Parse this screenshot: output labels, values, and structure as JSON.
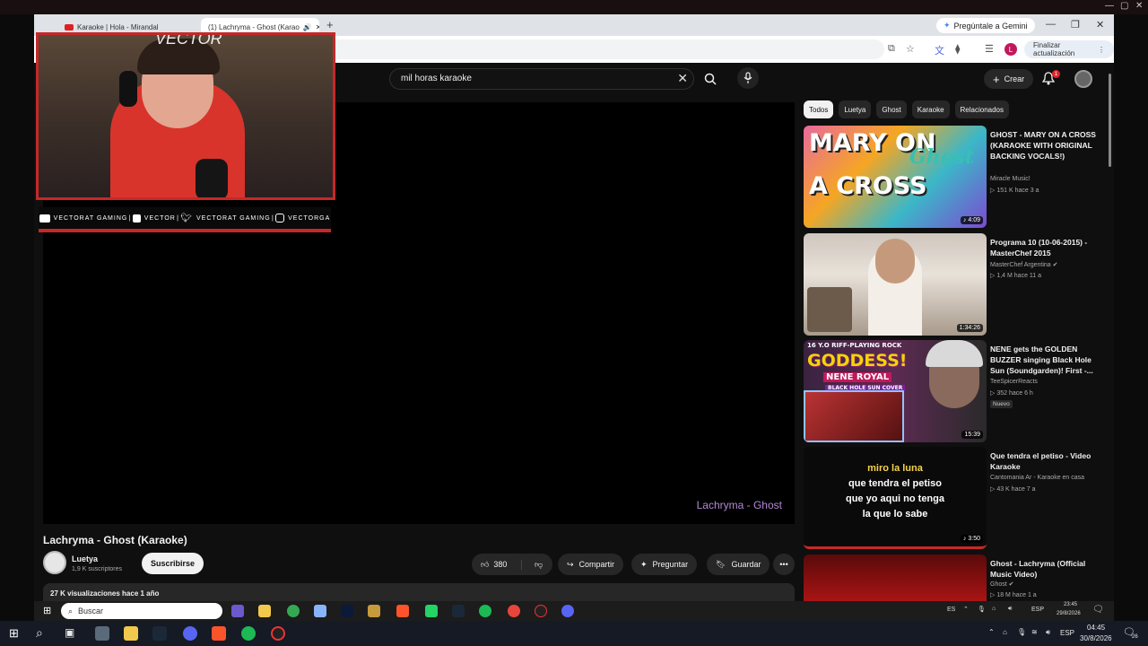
{
  "browser": {
    "tabs": [
      {
        "label": "Karaoke | Hola - Mirandal"
      },
      {
        "label": "(1) Lachryma - Ghost (Karao"
      }
    ],
    "gemini_label": "Pregúntale a Gemini",
    "update_label": "Finalizar actualización",
    "profile_letter": "L"
  },
  "header": {
    "search_value": "mil horas karaoke",
    "create_label": "Crear",
    "notification_count": "1"
  },
  "player": {
    "lyric_caption": "Lachryma - Ghost"
  },
  "video": {
    "title": "Lachryma - Ghost (Karaoke)",
    "channel": "Luetya",
    "subscribers": "1,9 K suscriptores",
    "subscribe_label": "Suscribirse",
    "likes": "380",
    "share_label": "Compartir",
    "ask_label": "Preguntar",
    "save_label": "Guardar",
    "description_meta": "27 K visualizaciones  hace 1 año"
  },
  "chips": [
    "Todos",
    "Luetya",
    "Ghost",
    "Karaoke",
    "Relacionados"
  ],
  "recommendations": [
    {
      "title": "GHOST - MARY ON A CROSS (KARAOKE WITH ORIGINAL BACKING VOCALS!)",
      "channel": "Miracle Music!",
      "meta": "▷ 151 K   hace 3 a",
      "duration": "4:09",
      "thumb_text": [
        "MARY ON",
        "A CROSS"
      ],
      "thumb_logo": "Ghost"
    },
    {
      "title": "Programa 10 (10-06-2015) - MasterChef 2015",
      "channel": "MasterChef Argentina",
      "meta": "▷ 1,4 M   hace 11 a",
      "duration": "1:34:26"
    },
    {
      "title": "NENE gets the GOLDEN BUZZER singing Black Hole Sun (Soundgarden)!  First -...",
      "channel": "TeeSpicerReacts",
      "meta": "▷ 352   hace 6 h",
      "badge": "Nuevo",
      "duration": "15:39",
      "thumb_text": [
        "16 Y.O RIFF-PLAYING ROCK",
        "GODDESS!",
        "NENE ROYAL",
        "BLACK HOLE SUN COVER"
      ]
    },
    {
      "title": "Que tendra el petiso - Video Karaoke",
      "channel": "Cantomania Ar - Karaoke en casa",
      "meta": "▷ 43 K   hace 7 a",
      "duration": "3:50",
      "thumb_lyrics": [
        "miro la luna",
        "que tendra el petiso",
        "que yo aqui no tenga",
        "la que lo sabe"
      ]
    },
    {
      "title": "Ghost - Lachryma (Official Music Video)",
      "channel": "Ghost",
      "meta": "▷ 18 M   hace 1 a"
    }
  ],
  "overlay": {
    "watermark": "VECTOR",
    "socials": [
      "VECTORAT GAMING",
      "VECTOR",
      "VECTORAT GAMING",
      "VECTORGA"
    ]
  },
  "inner_taskbar": {
    "search_placeholder": "Buscar",
    "lang": "ES",
    "kbd": "ESP",
    "time": "23:45",
    "date": "29/8/2026"
  },
  "taskbar": {
    "kbd": "ESP",
    "time": "04:45",
    "date": "30/8/2026",
    "notif": "26"
  },
  "colors": {
    "accent_red": "#c62828",
    "yt_bg": "#0f0f0f",
    "chip_bg": "#272727",
    "caption_purple": "#b48ad6"
  }
}
